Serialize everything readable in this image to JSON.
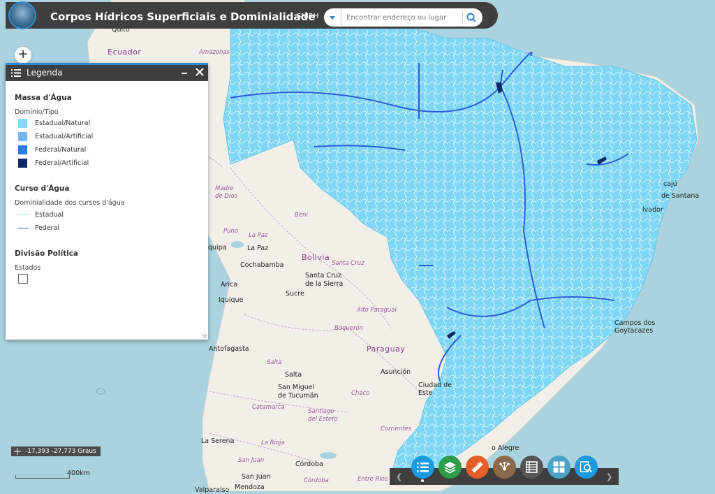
{
  "app": {
    "title": "Corpos Hídricos Superficiais e Dominialidade",
    "org_link": "SNIRH"
  },
  "search": {
    "placeholder": "Encontrar endereço ou lugar"
  },
  "colors": {
    "header_bg": "#3f3f3f",
    "accent": "#2c8cd1",
    "estadual_natural": "#7dddf7",
    "estadual_artificial": "#79b4f2",
    "federal_natural": "#2a7be6",
    "federal_artificial": "#0c2a66",
    "curso_estadual": "#9fd8f3",
    "curso_federal": "#2c5ed8"
  },
  "legend": {
    "title": "Legenda",
    "massa": {
      "heading": "Massa d'Água",
      "subheading": "Domínio/Tipo",
      "items": [
        {
          "label": "Estadual/Natural"
        },
        {
          "label": "Estadual/Artificial"
        },
        {
          "label": "Federal/Natural"
        },
        {
          "label": "Federal/Artificial"
        }
      ]
    },
    "curso": {
      "heading": "Curso d'Água",
      "subheading": "Dominialidade dos cursos d'água",
      "items": [
        {
          "label": "Estadual"
        },
        {
          "label": "Federal"
        }
      ]
    },
    "divisao": {
      "heading": "Divisão Política",
      "subheading": "Estados"
    }
  },
  "map_labels": {
    "quito": "Quito",
    "ecuador": "Ecuador",
    "amazonas": "Amazonas",
    "madre_de_dios": "Madre\nde Dios",
    "beni": "Beni",
    "puno": "Puno",
    "la_paz_region": "La Paz",
    "la_paz": "La Paz",
    "arequipa": "quipa",
    "bolivia": "Bolivia",
    "cochabamba": "Cochabamba",
    "santa_cruz_region": "Santa Cruz",
    "santa_cruz_city": "Santa Cruz\nde la Sierra",
    "arica": "Arica",
    "iquique": "Iquique",
    "sucre": "Sucre",
    "alto_paraguai": "Alto Paraguai",
    "boqueron": "Boquerón",
    "antofagasta": "Antofagasta",
    "paraguay": "Paraguay",
    "salta_region": "Salta",
    "salta": "Salta",
    "asuncion": "Asunción",
    "san_miguel": "San Miguel\nde Tucumán",
    "chaco": "Chaco",
    "catamarca": "Catamarca",
    "santiago_estero": "Santiago\ndel Estero",
    "corrientes": "Corrientes",
    "la_serena": "La Serena",
    "la_rioja": "La Rioja",
    "san_juan_region": "San Juan",
    "san_juan": "San Juan",
    "cordoba": "Córdoba",
    "cordoba_region": "Córdoba",
    "entre_rios": "Entre Ríos",
    "mendoza": "Mendoza",
    "valparaiso": "Valparaíso",
    "ciudad_del_este": "Ciudad de\nEste",
    "porto_alegre": "o Alegre",
    "campos": "Campos dos\nGoytacazes",
    "santana": "de Santana",
    "salvador": "lvador",
    "cajazu": "cajú"
  },
  "coords": {
    "text": "-17,393 -27,773 Graus"
  },
  "scale": {
    "label": "400km"
  },
  "toolbar": {
    "buttons": [
      {
        "name": "legend-list-icon",
        "color": "#1a9be0"
      },
      {
        "name": "layers-icon",
        "color": "#2e9c48"
      },
      {
        "name": "measure-icon",
        "color": "#e35f27"
      },
      {
        "name": "share-icon",
        "color": "#8a6a4a"
      },
      {
        "name": "attribute-table-icon",
        "color": "#555555"
      },
      {
        "name": "basemap-gallery-icon",
        "color": "#4aa3c9"
      },
      {
        "name": "query-search-icon",
        "color": "#1a9be0"
      }
    ]
  }
}
